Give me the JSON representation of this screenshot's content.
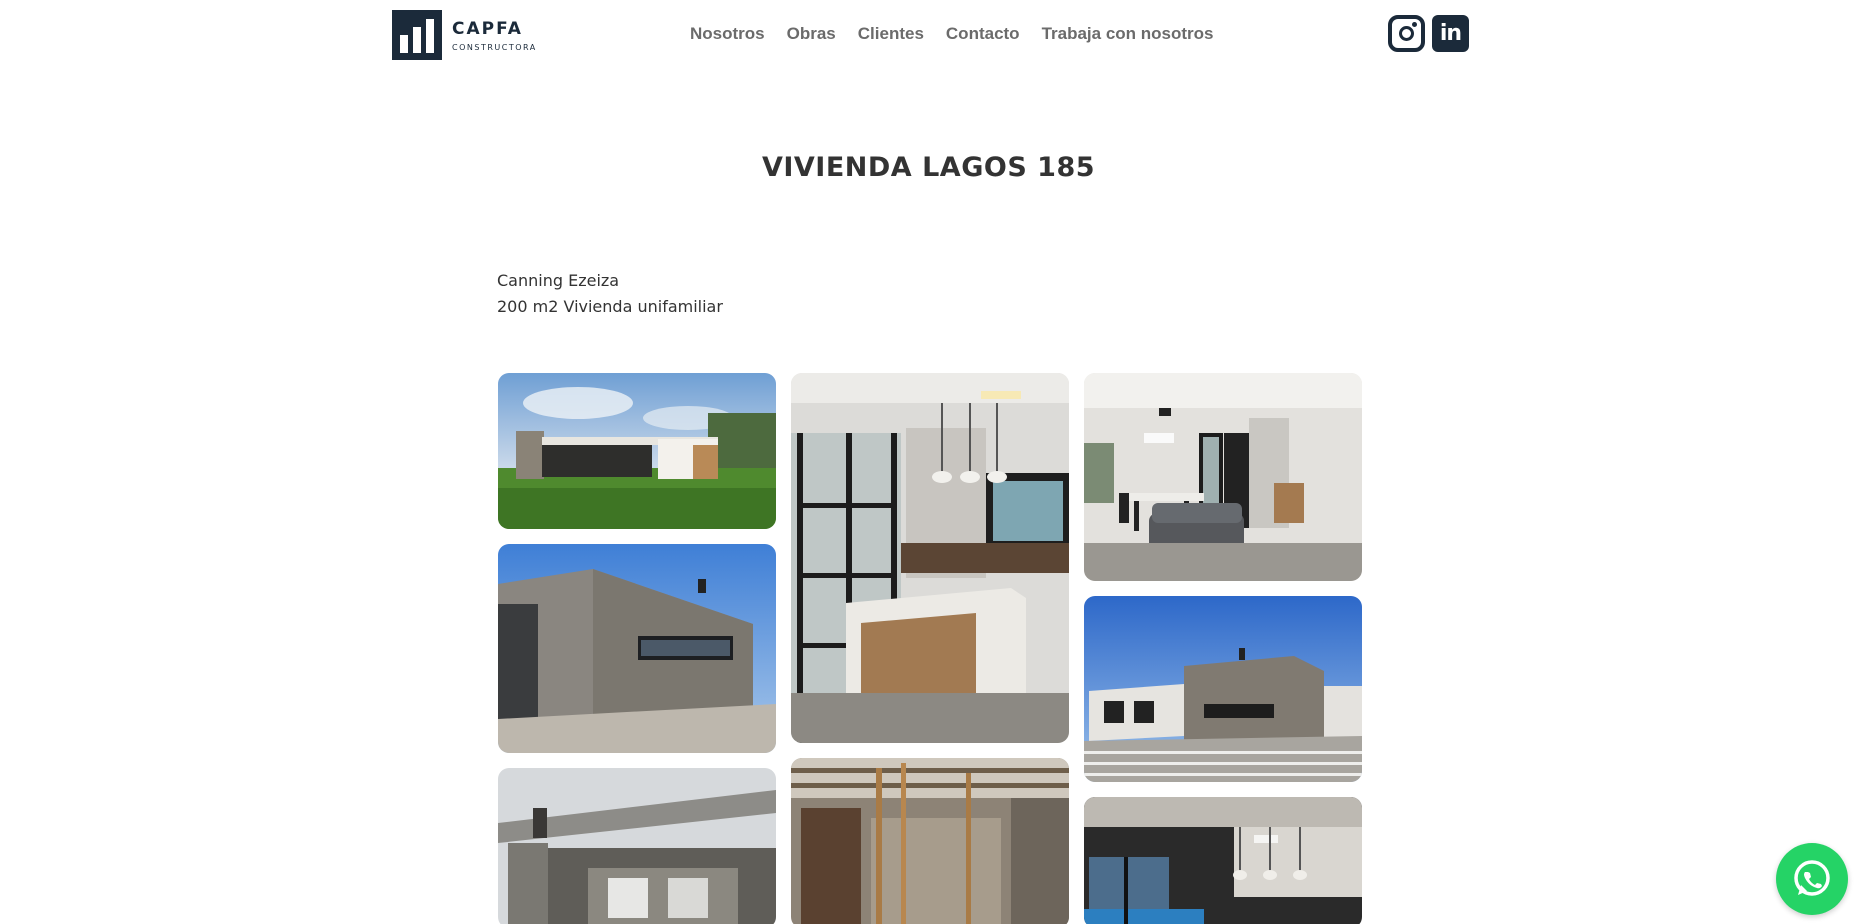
{
  "header": {
    "logo": {
      "name": "CAPFA",
      "subtitle": "CONSTRUCTORA"
    },
    "nav": [
      {
        "label": "Nosotros"
      },
      {
        "label": "Obras"
      },
      {
        "label": "Clientes"
      },
      {
        "label": "Contacto"
      },
      {
        "label": "Trabaja con nosotros"
      }
    ],
    "social": {
      "instagram_icon": "instagram-icon",
      "linkedin_icon": "linkedin-icon",
      "linkedin_text": "in"
    }
  },
  "project": {
    "title": "VIVIENDA LAGOS 185",
    "location": "Canning Ezeiza",
    "details": "200 m2 Vivienda unifamiliar"
  },
  "gallery": [
    {
      "subject": "exterior-render-house-lawn"
    },
    {
      "subject": "stone-facade-exterior"
    },
    {
      "subject": "construction-concrete-structure"
    },
    {
      "subject": "kitchen-island-interior"
    },
    {
      "subject": "construction-interior-beams"
    },
    {
      "subject": "living-dining-interior"
    },
    {
      "subject": "stone-house-exterior-blue-sky"
    },
    {
      "subject": "interior-dining-pendant-lights"
    }
  ],
  "floating": {
    "whatsapp_icon": "whatsapp-icon"
  },
  "colors": {
    "brand": "#1b2a3a",
    "nav_text": "#6b6b6b",
    "whatsapp": "#25d366"
  }
}
